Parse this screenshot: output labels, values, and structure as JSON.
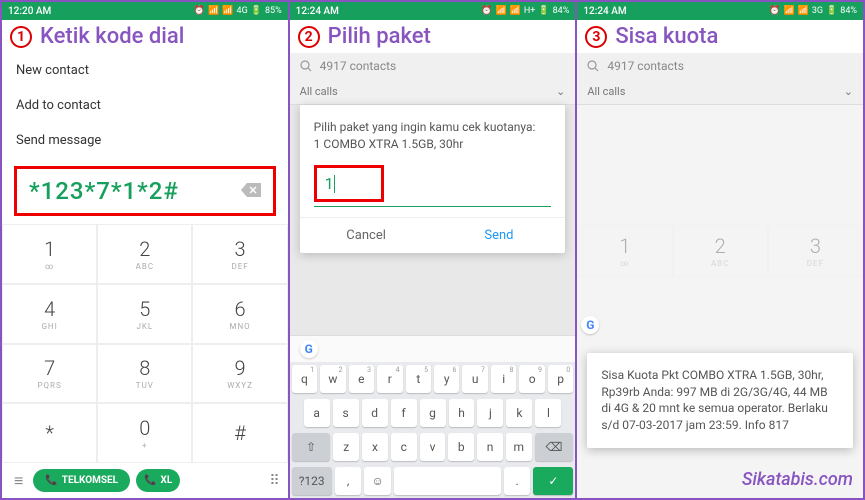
{
  "panels": [
    {
      "step": "1",
      "title": "Ketik kode dial",
      "statusbar": {
        "time": "12:20 AM",
        "net": "4G",
        "battery": "85%"
      },
      "menu": [
        "New contact",
        "Add to contact",
        "Send message"
      ],
      "dial_code": "*123*7*1*2#",
      "keypad": [
        {
          "n": "1",
          "s": "∞"
        },
        {
          "n": "2",
          "s": "ABC"
        },
        {
          "n": "3",
          "s": "DEF"
        },
        {
          "n": "4",
          "s": "GHI"
        },
        {
          "n": "5",
          "s": "JKL"
        },
        {
          "n": "6",
          "s": "MNO"
        },
        {
          "n": "7",
          "s": "PQRS"
        },
        {
          "n": "8",
          "s": "TUV"
        },
        {
          "n": "9",
          "s": "WXYZ"
        },
        {
          "n": "*",
          "s": ""
        },
        {
          "n": "0",
          "s": "+"
        },
        {
          "n": "#",
          "s": ""
        }
      ],
      "call1": "TELKOMSEL",
      "call2": "XL"
    },
    {
      "step": "2",
      "title": "Pilih paket",
      "statusbar": {
        "time": "12:24 AM",
        "net": "H+",
        "battery": "84%"
      },
      "search": "4917 contacts",
      "filter": "All calls",
      "modal": {
        "msg": "Pilih paket yang ingin kamu cek kuotanya:\n1 COMBO XTRA 1.5GB, 30hr",
        "input": "1",
        "cancel": "Cancel",
        "send": "Send"
      },
      "kb_rows": [
        [
          {
            "k": "q",
            "s": "1"
          },
          {
            "k": "w",
            "s": "2"
          },
          {
            "k": "e",
            "s": "3"
          },
          {
            "k": "r",
            "s": "4"
          },
          {
            "k": "t",
            "s": "5"
          },
          {
            "k": "y",
            "s": "6"
          },
          {
            "k": "u",
            "s": "7"
          },
          {
            "k": "i",
            "s": "8"
          },
          {
            "k": "o",
            "s": "9"
          },
          {
            "k": "p",
            "s": "0"
          }
        ],
        [
          {
            "k": "a"
          },
          {
            "k": "s"
          },
          {
            "k": "d"
          },
          {
            "k": "f"
          },
          {
            "k": "g"
          },
          {
            "k": "h"
          },
          {
            "k": "j"
          },
          {
            "k": "k"
          },
          {
            "k": "l"
          }
        ],
        [
          {
            "k": "z"
          },
          {
            "k": "x"
          },
          {
            "k": "c"
          },
          {
            "k": "v"
          },
          {
            "k": "b"
          },
          {
            "k": "n"
          },
          {
            "k": "m"
          }
        ]
      ],
      "kb_bottom": {
        "sym": "?123",
        "comma": ",",
        "emoji": "☺",
        "dot": ".",
        "enter": "↵"
      }
    },
    {
      "step": "3",
      "title": "Sisa kuota",
      "statusbar": {
        "time": "12:24 AM",
        "net": "3G",
        "battery": "84%"
      },
      "search": "4917 contacts",
      "filter": "All calls",
      "keypad_faded": [
        {
          "n": "1",
          "s": "∞"
        },
        {
          "n": "2",
          "s": "ABC"
        },
        {
          "n": "3",
          "s": "DEF"
        }
      ],
      "result": "Sisa Kuota Pkt  COMBO XTRA 1.5GB, 30hr, Rp39rb Anda: 997 MB di 2G/3G/4G,  44 MB di 4G & 20 mnt  ke semua operator. Berlaku s/d 07-03-2017 jam 23:59. Info 817"
    }
  ],
  "watermark": "Sikatabis.com"
}
